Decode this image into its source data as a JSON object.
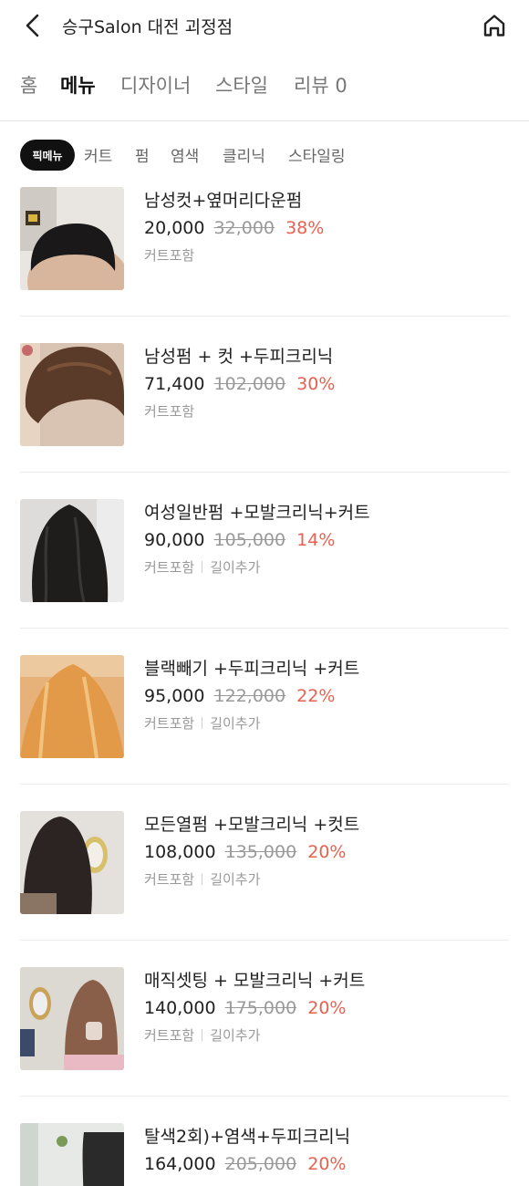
{
  "header": {
    "title": "승구Salon 대전 괴정점",
    "back_icon": "chevron-left-icon",
    "home_icon": "home-icon"
  },
  "main_tabs": [
    {
      "label": "홈",
      "active": false
    },
    {
      "label": "메뉴",
      "active": true
    },
    {
      "label": "디자이너",
      "active": false
    },
    {
      "label": "스타일",
      "active": false
    },
    {
      "label": "리뷰 0",
      "active": false
    }
  ],
  "sub_tabs": [
    {
      "label": "픽메뉴",
      "active": true
    },
    {
      "label": "커트",
      "active": false
    },
    {
      "label": "펌",
      "active": false
    },
    {
      "label": "염색",
      "active": false
    },
    {
      "label": "클리닉",
      "active": false
    },
    {
      "label": "스타일링",
      "active": false
    }
  ],
  "menu_items": [
    {
      "name": "남성컷+옆머리다운펌",
      "price": "20,000",
      "original_price": "32,000",
      "discount": "38%",
      "tags": [
        "커트포함"
      ]
    },
    {
      "name": "남성펌 + 컷 +두피크리닉",
      "price": "71,400",
      "original_price": "102,000",
      "discount": "30%",
      "tags": [
        "커트포함"
      ]
    },
    {
      "name": "여성일반펌 +모발크리닉+커트",
      "price": "90,000",
      "original_price": "105,000",
      "discount": "14%",
      "tags": [
        "커트포함",
        "길이추가"
      ]
    },
    {
      "name": "블랙빼기 +두피크리닉 +커트",
      "price": "95,000",
      "original_price": "122,000",
      "discount": "22%",
      "tags": [
        "커트포함",
        "길이추가"
      ]
    },
    {
      "name": "모든열펌 +모발크리닉 +컷트",
      "price": "108,000",
      "original_price": "135,000",
      "discount": "20%",
      "tags": [
        "커트포함",
        "길이추가"
      ]
    },
    {
      "name": "매직셋팅 + 모발크리닉 +커트",
      "price": "140,000",
      "original_price": "175,000",
      "discount": "20%",
      "tags": [
        "커트포함",
        "길이추가"
      ]
    },
    {
      "name": "탈색2회)+염색+두피크리닉",
      "price": "164,000",
      "original_price": "205,000",
      "discount": "20%",
      "tags": []
    }
  ],
  "colors": {
    "discount": "#e8614f",
    "active_tab_highlight": "#ffe600",
    "pill_bg": "#111111"
  }
}
